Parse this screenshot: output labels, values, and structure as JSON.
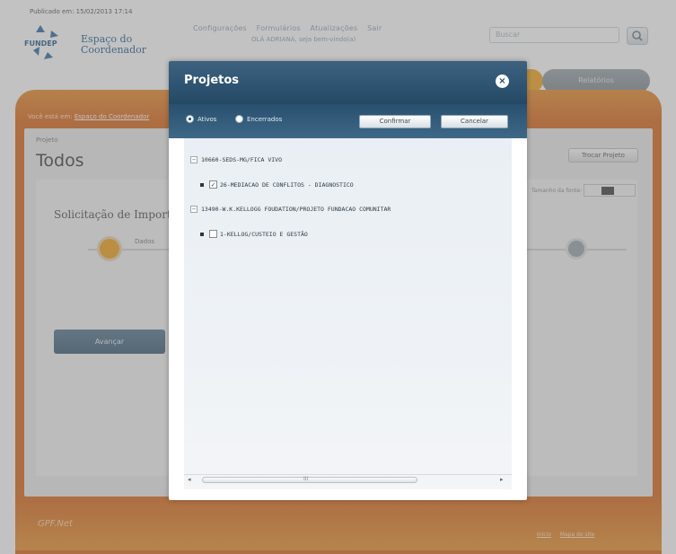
{
  "header": {
    "publication": "Publicado em: 15/02/2013 17:14",
    "logo_word": "FUNDEP",
    "logo_title_1": "Espaço do",
    "logo_title_2": "Coordenador",
    "top_links": [
      "Configurações",
      "Formulários",
      "Atualizações",
      "Sair"
    ],
    "user_line": "OLÁ ADRIANA, seja bem-vindo(a)",
    "search_placeholder": "Buscar",
    "action_pill": "Relatórios"
  },
  "band": {
    "crumb_prefix": "Você está em:",
    "crumb_link": "Espaço do Coordenador"
  },
  "main": {
    "project_label": "Projeto",
    "project_value": "Todos",
    "change_project": "Trocar Projeto",
    "font_size_label": "Tamanho da fonte:",
    "section_title": "Solicitação de Importação",
    "step1_label": "Dados",
    "next_button": "Avançar"
  },
  "footer": {
    "logo": "GPF.Net",
    "links": [
      "Início",
      "Mapa do site"
    ]
  },
  "modal": {
    "title": "Projetos",
    "close": "×",
    "radio_all": "Ativos",
    "radio_closed": "Encerrados",
    "confirm": "Confirmar",
    "cancel": "Cancelar",
    "tree": [
      {
        "label": "10660-SEDS-MG/FICA VIVO",
        "children": [
          {
            "label": "26-MEDIACAO DE CONFLITOS - DIAGNOSTICO",
            "checked": true
          }
        ]
      },
      {
        "label": "13490-W.K.KELLOGG FOUDATION/PROJETO FUNDACAO COMUNITAR",
        "children": [
          {
            "label": "1-KELLOG/CUSTEIO E GESTÃO",
            "checked": false
          }
        ]
      }
    ],
    "scroll_label": "III"
  }
}
